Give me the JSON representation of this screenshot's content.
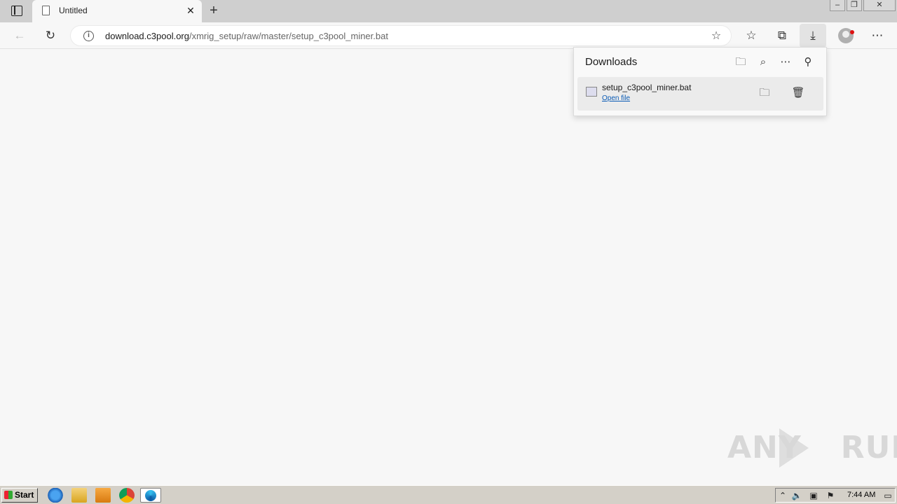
{
  "browser": {
    "tab": {
      "title": "Untitled"
    },
    "address": {
      "domain": "download.c3pool.org",
      "path": "/xmrig_setup/raw/master/setup_c3pool_miner.bat"
    }
  },
  "downloads_panel": {
    "title": "Downloads",
    "items": [
      {
        "file_name": "setup_c3pool_miner.bat",
        "action_label": "Open file"
      }
    ]
  },
  "watermark": {
    "text": "ANY",
    "text2": "RUN"
  },
  "taskbar": {
    "start_label": "Start",
    "clock": "7:44 AM"
  },
  "icons": {
    "tab_actions": "tab-actions-icon",
    "new_tab": "plus-icon",
    "back": "back-arrow-icon",
    "refresh": "refresh-icon",
    "info": "info-icon",
    "favorite": "add-favorite-icon",
    "favorites": "favorites-icon",
    "collections": "collections-icon",
    "downloads": "download-icon",
    "more": "more-icon"
  },
  "colors": {
    "link": "#0a5bb5",
    "accent_dot": "#dd1111"
  }
}
